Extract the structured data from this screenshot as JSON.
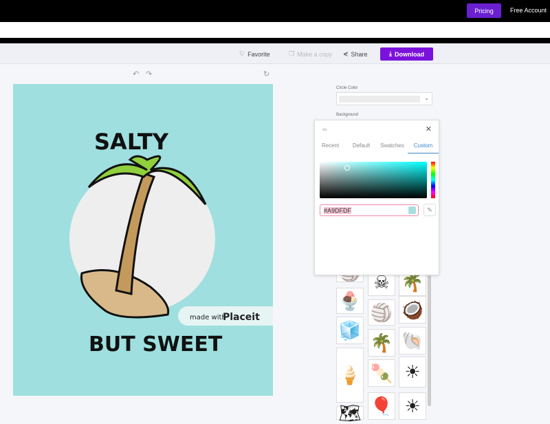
{
  "header": {
    "pricing": "Pricing",
    "free_account": "Free Account"
  },
  "toolbar": {
    "favorite": "Favorite",
    "make_copy": "Make a copy",
    "share": "Share",
    "download": "Download"
  },
  "canvas": {
    "top_text": "SALTY",
    "bottom_text": "BUT SWEET",
    "watermark_prefix": "made with",
    "watermark_brand": "Placeit",
    "background_color": "#A9DFDF"
  },
  "panel": {
    "circle_color_label": "Circle Color",
    "background_label": "Background"
  },
  "picker": {
    "tabs": [
      "Recent",
      "Default",
      "Swatches",
      "Custom"
    ],
    "active_tab": "Custom",
    "hex_value": "#A9DFDF"
  },
  "icons": [
    "🏐",
    "☠",
    "🌴",
    "🍨",
    "🏐",
    "🥥",
    "🧊",
    "🌴",
    "🐚",
    "🍦",
    "🍡",
    "☀",
    "🗺",
    "🎈",
    "☀"
  ]
}
